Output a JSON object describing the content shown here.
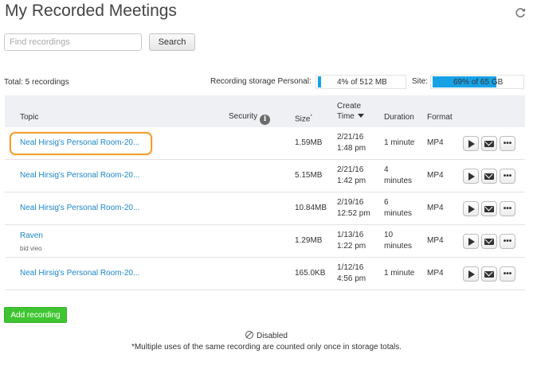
{
  "page": {
    "title": "My Recorded Meetings"
  },
  "search": {
    "placeholder": "Find recordings",
    "button_label": "Search"
  },
  "summary": {
    "total": "Total: 5 recordings",
    "storage_label": "Recording storage Personal:",
    "storage_text": "4% of 512 MB",
    "storage_percent": 4,
    "site_label": "Site:",
    "site_text": "69% of 65 GB",
    "site_percent": 69,
    "bar_color": "#18a2e6"
  },
  "table": {
    "headers": {
      "topic": "Topic",
      "security": "Security",
      "size": "Size",
      "size_mark": "*",
      "create_time_1": "Create",
      "create_time_2": "Time",
      "duration": "Duration",
      "format": "Format"
    },
    "rows": [
      {
        "topic": "Neal Hirsig's Personal Room-20...",
        "sub": "",
        "size": "1.59MB",
        "date": "2/21/16",
        "time": "1:48 pm",
        "duration_1": "1 minute",
        "duration_2": "",
        "format": "MP4",
        "highlighted": true
      },
      {
        "topic": "Neal Hirsig's Personal Room-20...",
        "sub": "",
        "size": "5.15MB",
        "date": "2/21/16",
        "time": "1:42 pm",
        "duration_1": "4",
        "duration_2": "minutes",
        "format": "MP4",
        "highlighted": false
      },
      {
        "topic": "Neal Hirsig's Personal Room-20...",
        "sub": "",
        "size": "10.84MB",
        "date": "2/19/16",
        "time": "12:52 pm",
        "duration_1": "6",
        "duration_2": "minutes",
        "format": "MP4",
        "highlighted": false
      },
      {
        "topic": "Raven",
        "sub": "bid vieo",
        "size": "1.29MB",
        "date": "1/13/16",
        "time": "1:22 pm",
        "duration_1": "10",
        "duration_2": "minutes",
        "format": "MP4",
        "highlighted": false
      },
      {
        "topic": "Neal Hirsig's Personal Room-20...",
        "sub": "",
        "size": "165.0KB",
        "date": "1/12/16",
        "time": "4:56 pm",
        "duration_1": "1 minute",
        "duration_2": "",
        "format": "MP4",
        "highlighted": false
      }
    ]
  },
  "actions": {
    "add_recording": "Add recording",
    "disabled_label": "Disabled",
    "footnote": "*Multiple uses of the same recording are counted only once in storage totals.",
    "add_color": "#3ec531"
  },
  "icons": {
    "refresh": "refresh-icon",
    "info": "info-icon",
    "sort": "sort-down-icon",
    "play": "play-icon",
    "mail": "mail-icon",
    "more": "more-icon",
    "disabled": "disabled-icon"
  }
}
